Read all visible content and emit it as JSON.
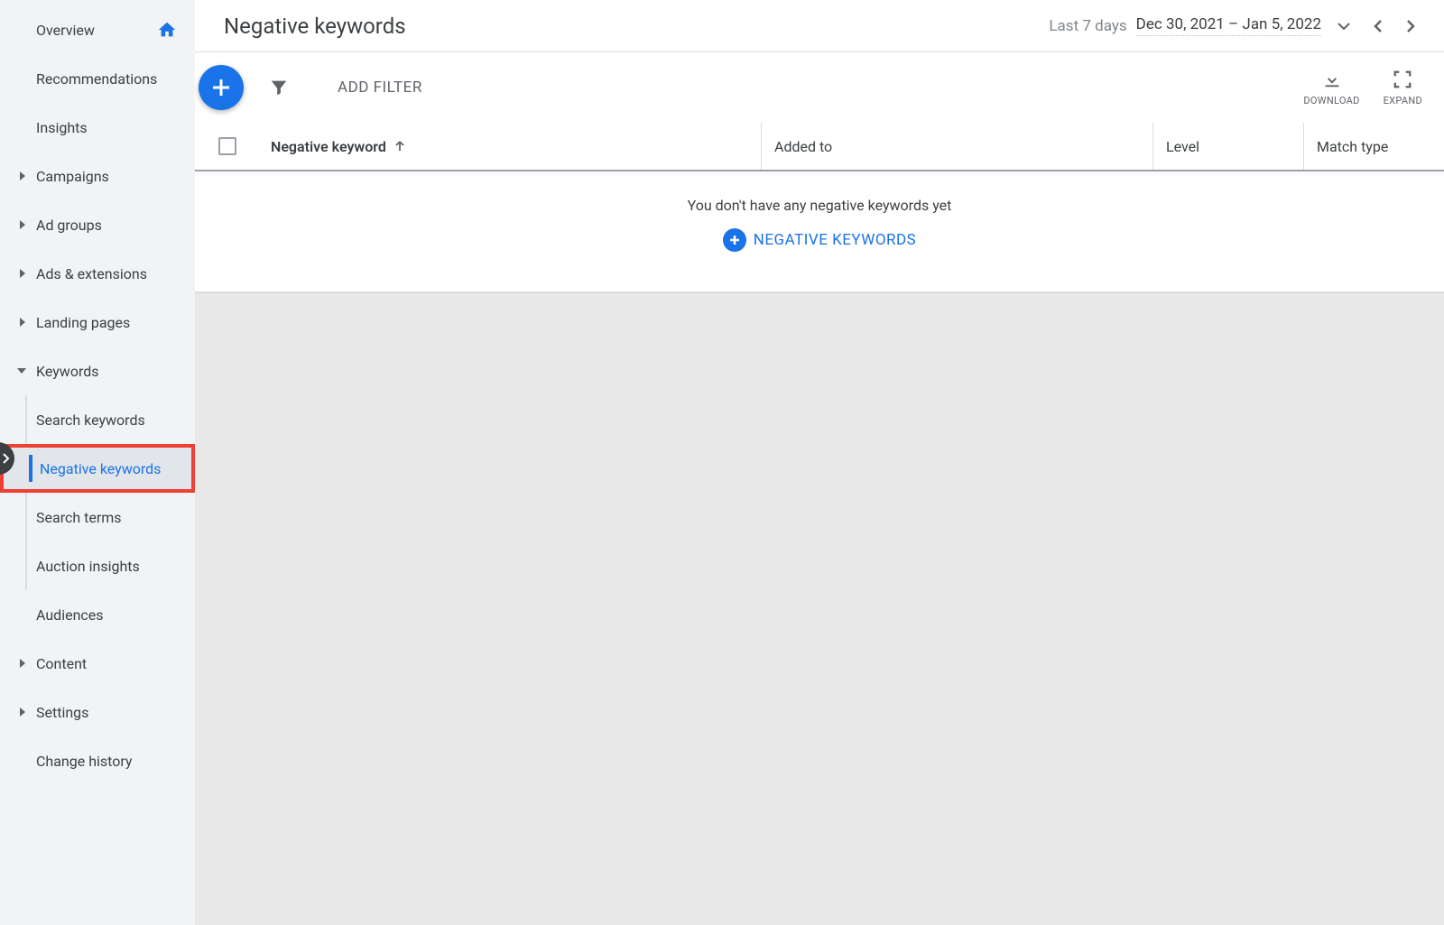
{
  "sidebar": {
    "overview": "Overview",
    "recommendations": "Recommendations",
    "insights": "Insights",
    "campaigns": "Campaigns",
    "ad_groups": "Ad groups",
    "ads_extensions": "Ads & extensions",
    "landing_pages": "Landing pages",
    "keywords": "Keywords",
    "sub": {
      "search_keywords": "Search keywords",
      "negative_keywords": "Negative keywords",
      "search_terms": "Search terms",
      "auction_insights": "Auction insights"
    },
    "audiences": "Audiences",
    "content": "Content",
    "settings": "Settings",
    "change_history": "Change history"
  },
  "header": {
    "title": "Negative keywords",
    "date_label": "Last 7 days",
    "date_value": "Dec 30, 2021 – Jan 5, 2022"
  },
  "toolbar": {
    "add_filter": "ADD FILTER",
    "download": "DOWNLOAD",
    "expand": "EXPAND"
  },
  "table": {
    "col_keyword": "Negative keyword",
    "col_added": "Added to",
    "col_level": "Level",
    "col_match": "Match type"
  },
  "empty": {
    "text": "You don't have any negative keywords yet",
    "cta": "NEGATIVE KEYWORDS"
  }
}
